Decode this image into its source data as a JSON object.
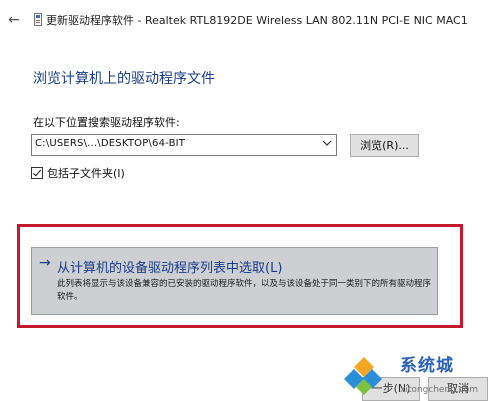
{
  "titlebar": {
    "back_glyph": "←",
    "title": "更新驱动程序软件 - Realtek RTL8192DE Wireless LAN 802.11N PCI-E NIC MAC1"
  },
  "main": {
    "heading": "浏览计算机上的驱动程序文件",
    "search_label": "在以下位置搜索驱动程序软件:",
    "path_value": "C:\\USERS\\...\\DESKTOP\\64-BIT",
    "browse_label": "浏览(R)...",
    "include_subfolders": {
      "label": "包括子文件夹(I)",
      "checked": true
    },
    "pick_option": {
      "arrow": "→",
      "title": "从计算机的设备驱动程序列表中选取(L)",
      "description": "此列表将显示与该设备兼容的已安装的驱动程序软件，以及与该设备处于同一类别下的所有驱动程序软件。"
    }
  },
  "footer": {
    "next_label": "一步(N)",
    "cancel_label": "取消"
  },
  "watermark": {
    "text": "系统城",
    "url": "xitongcheng.com"
  },
  "colors": {
    "heading_blue": "#1a3d8a",
    "highlight_red": "#c41a2c",
    "watermark_blue": "#2a63b8"
  }
}
